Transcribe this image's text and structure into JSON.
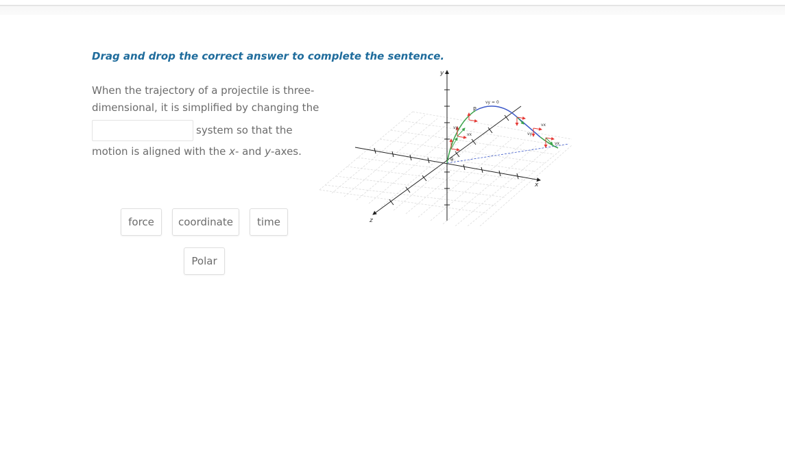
{
  "instruction": "Drag and drop the correct answer to complete the sentence.",
  "sentence": {
    "line1": "When the trajectory of a projectile is three-",
    "line2": "dimensional, it is simplified by changing the",
    "after_blank": "system so that the",
    "line4_pre": "motion is aligned with the ",
    "x_var": "x",
    "line4_mid": "- and ",
    "y_var": "y",
    "line4_post": "-axes."
  },
  "drop_zone": {
    "value": ""
  },
  "choices": [
    "force",
    "coordinate",
    "time",
    "Polar"
  ],
  "figure": {
    "axis_labels": {
      "x": "x",
      "y": "y",
      "z": "z"
    },
    "labels": [
      "θ",
      "P",
      "vy = 0",
      "vx",
      "vy",
      "vx",
      "vy",
      "vx"
    ],
    "colors": {
      "velocity_arrow": "#e53935",
      "trajectory_rise": "#3aa34a",
      "trajectory_top": "#3a57c8",
      "projection": "#3a57c8"
    }
  }
}
